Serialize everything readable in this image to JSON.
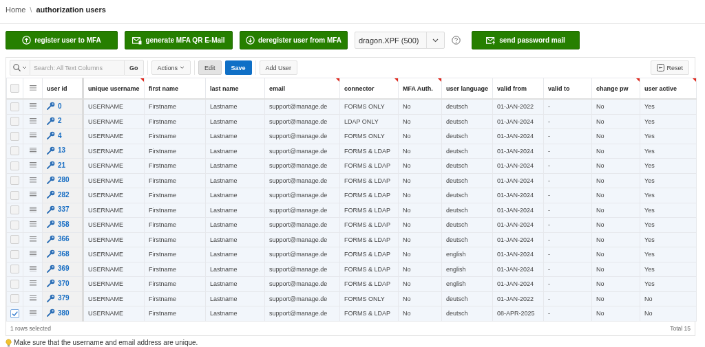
{
  "breadcrumb": {
    "items": [
      {
        "label": "Home",
        "current": false
      },
      {
        "label": "authorization users",
        "current": true
      }
    ],
    "separator": "\\"
  },
  "action_bar": {
    "items": [
      {
        "kind": "register",
        "label": "register user to MFA"
      },
      {
        "kind": "generate",
        "label": "generate MFA QR E-Mail"
      },
      {
        "kind": "deregister",
        "label": "deregister user from MFA"
      },
      {
        "kind": "select",
        "value": "dragon.XPF (500)"
      },
      {
        "kind": "help"
      },
      {
        "kind": "send",
        "label": "send password mail"
      }
    ]
  },
  "toolbar": {
    "search": {
      "placeholder": "Search: All Text Columns"
    },
    "go": "Go",
    "actions": "Actions",
    "edit": {
      "label": "Edit",
      "pressed": true
    },
    "save": "Save",
    "add_user": "Add User",
    "reset": "Reset"
  },
  "table": {
    "all_selected": false,
    "columns": [
      {
        "label": "user id",
        "flagged": false
      },
      {
        "label": "unique username",
        "flagged": true
      },
      {
        "label": "first name",
        "flagged": false
      },
      {
        "label": "last name",
        "flagged": false
      },
      {
        "label": "email",
        "flagged": true
      },
      {
        "label": "connector",
        "flagged": true
      },
      {
        "label": "MFA Auth.",
        "flagged": true
      },
      {
        "label": "user language",
        "flagged": false
      },
      {
        "label": "valid from",
        "flagged": false
      },
      {
        "label": "valid to",
        "flagged": false
      },
      {
        "label": "change pw",
        "flagged": true
      },
      {
        "label": "user active",
        "flagged": true
      }
    ],
    "rows": [
      {
        "selected": false,
        "cells": [
          "0",
          "USERNAME",
          "Firstname",
          "Lastname",
          "support@manage.de",
          "FORMS ONLY",
          "No",
          "deutsch",
          "01-JAN-2022",
          "-",
          "No",
          "Yes"
        ]
      },
      {
        "selected": false,
        "cells": [
          "2",
          "USERNAME",
          "Firstname",
          "Lastname",
          "support@manage.de",
          "LDAP ONLY",
          "No",
          "deutsch",
          "01-JAN-2024",
          "-",
          "No",
          "Yes"
        ]
      },
      {
        "selected": false,
        "cells": [
          "4",
          "USERNAME",
          "Firstname",
          "Lastname",
          "support@manage.de",
          "FORMS ONLY",
          "No",
          "deutsch",
          "01-JAN-2024",
          "-",
          "No",
          "Yes"
        ]
      },
      {
        "selected": false,
        "cells": [
          "13",
          "USERNAME",
          "Firstname",
          "Lastname",
          "support@manage.de",
          "FORMS & LDAP",
          "No",
          "deutsch",
          "01-JAN-2024",
          "-",
          "No",
          "Yes"
        ]
      },
      {
        "selected": false,
        "cells": [
          "21",
          "USERNAME",
          "Firstname",
          "Lastname",
          "support@manage.de",
          "FORMS & LDAP",
          "No",
          "deutsch",
          "01-JAN-2024",
          "-",
          "No",
          "Yes"
        ]
      },
      {
        "selected": false,
        "cells": [
          "280",
          "USERNAME",
          "Firstname",
          "Lastname",
          "support@manage.de",
          "FORMS & LDAP",
          "No",
          "deutsch",
          "01-JAN-2024",
          "-",
          "No",
          "Yes"
        ]
      },
      {
        "selected": false,
        "cells": [
          "282",
          "USERNAME",
          "Firstname",
          "Lastname",
          "support@manage.de",
          "FORMS & LDAP",
          "No",
          "deutsch",
          "01-JAN-2024",
          "-",
          "No",
          "Yes"
        ]
      },
      {
        "selected": false,
        "cells": [
          "337",
          "USERNAME",
          "Firstname",
          "Lastname",
          "support@manage.de",
          "FORMS & LDAP",
          "No",
          "deutsch",
          "01-JAN-2024",
          "-",
          "No",
          "Yes"
        ]
      },
      {
        "selected": false,
        "cells": [
          "358",
          "USERNAME",
          "Firstname",
          "Lastname",
          "support@manage.de",
          "FORMS & LDAP",
          "No",
          "deutsch",
          "01-JAN-2024",
          "-",
          "No",
          "Yes"
        ]
      },
      {
        "selected": false,
        "cells": [
          "366",
          "USERNAME",
          "Firstname",
          "Lastname",
          "support@manage.de",
          "FORMS & LDAP",
          "No",
          "deutsch",
          "01-JAN-2024",
          "-",
          "No",
          "Yes"
        ]
      },
      {
        "selected": false,
        "cells": [
          "368",
          "USERNAME",
          "Firstname",
          "Lastname",
          "support@manage.de",
          "FORMS & LDAP",
          "No",
          "english",
          "01-JAN-2024",
          "-",
          "No",
          "Yes"
        ]
      },
      {
        "selected": false,
        "cells": [
          "369",
          "USERNAME",
          "Firstname",
          "Lastname",
          "support@manage.de",
          "FORMS & LDAP",
          "No",
          "english",
          "01-JAN-2024",
          "-",
          "No",
          "Yes"
        ]
      },
      {
        "selected": false,
        "cells": [
          "370",
          "USERNAME",
          "Firstname",
          "Lastname",
          "support@manage.de",
          "FORMS & LDAP",
          "No",
          "english",
          "01-JAN-2024",
          "-",
          "No",
          "Yes"
        ]
      },
      {
        "selected": false,
        "cells": [
          "379",
          "USERNAME",
          "Firstname",
          "Lastname",
          "support@manage.de",
          "FORMS ONLY",
          "No",
          "deutsch",
          "01-JAN-2022",
          "-",
          "No",
          "No"
        ]
      },
      {
        "selected": true,
        "cells": [
          "380",
          "USERNAME",
          "Firstname",
          "Lastname",
          "support@manage.de",
          "FORMS & LDAP",
          "No",
          "deutsch",
          "08-APR-2025",
          "-",
          "No",
          "No"
        ]
      }
    ]
  },
  "footer": {
    "selection_status": "1 rows selected",
    "total": "Total 15"
  },
  "hint": "Make sure that the username and email address are unique."
}
